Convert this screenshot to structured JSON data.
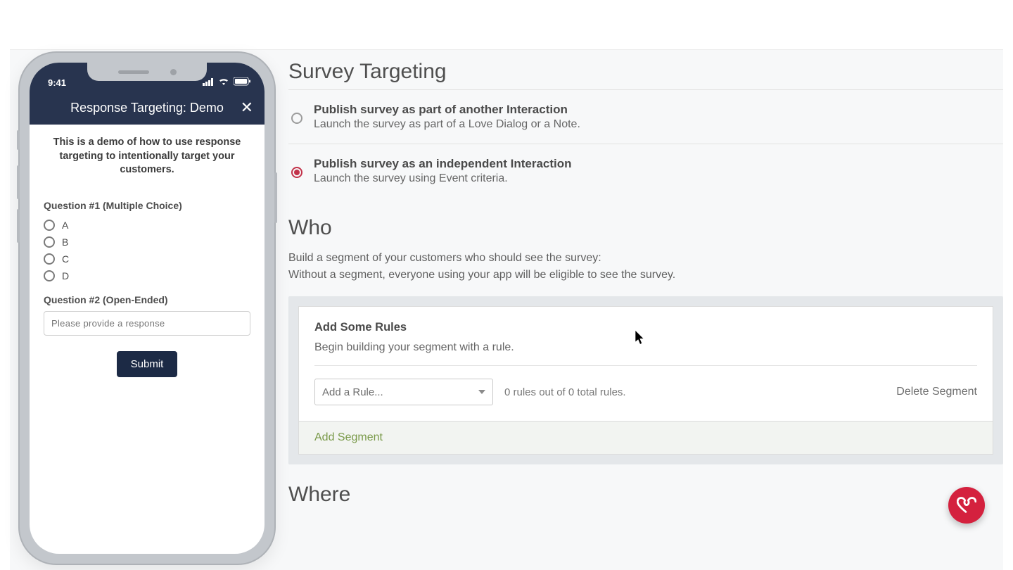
{
  "phone": {
    "time": "9:41",
    "header_title": "Response Targeting: Demo",
    "intro": "This is a demo of how to use response targeting to intentionally target your customers.",
    "q1_label": "Question #1 (Multiple Choice)",
    "choices": [
      "A",
      "B",
      "C",
      "D"
    ],
    "q2_label": "Question #2 (Open-Ended)",
    "response_placeholder": "Please provide a response",
    "submit_label": "Submit"
  },
  "main": {
    "page_title": "Survey Targeting",
    "options": [
      {
        "title": "Publish survey as part of another Interaction",
        "sub": "Launch the survey as part of a Love Dialog or a Note.",
        "selected": false
      },
      {
        "title": "Publish survey as an independent Interaction",
        "sub": "Launch the survey using Event criteria.",
        "selected": true
      }
    ],
    "who_title": "Who",
    "who_desc_line1": "Build a segment of your customers who should see the survey:",
    "who_desc_line2": "Without a segment, everyone using your app will be eligible to see the survey.",
    "segment": {
      "title": "Add Some Rules",
      "sub": "Begin building your segment with a rule.",
      "rule_select_label": "Add a Rule...",
      "rule_count": "0 rules out of 0 total rules.",
      "delete_label": "Delete Segment",
      "add_segment_label": "Add Segment"
    },
    "where_title": "Where"
  },
  "colors": {
    "accent_red": "#d4213e",
    "header_navy": "#28344f",
    "segment_green": "#7a9a4a"
  }
}
